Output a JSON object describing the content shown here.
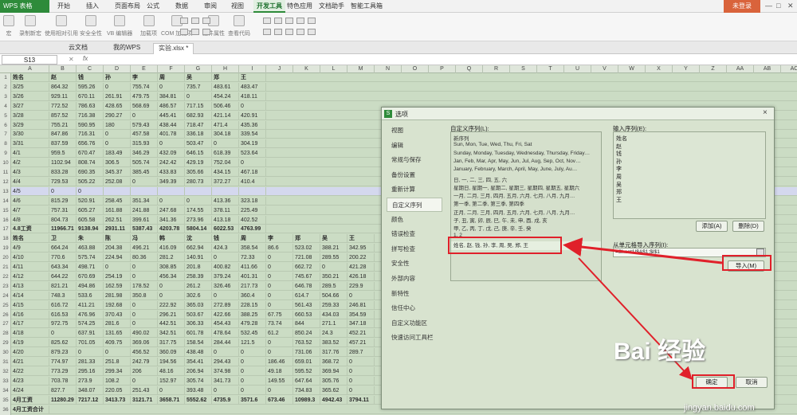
{
  "app": {
    "name": "WPS 表格"
  },
  "menu": [
    "开始",
    "插入",
    "页面布局",
    "公式",
    "数据",
    "审阅",
    "视图",
    "开发工具",
    "特色应用",
    "文档助手",
    "智能工具箱"
  ],
  "active_menu_index": 7,
  "login_label": "未登录",
  "toolbar": [
    "宏",
    "录制新宏",
    "使用相对引用",
    "安全全性",
    "VB 编辑器",
    "加载项",
    "COM 加载项",
    "控件属性",
    "查看代码"
  ],
  "doc_tabs": [
    "云文档",
    "我的WPS",
    "实验.xlsx *"
  ],
  "active_doc_tab_index": 2,
  "namebox": "S13",
  "fx": "fx",
  "columns": [
    "A",
    "B",
    "C",
    "D",
    "E",
    "F",
    "G",
    "H",
    "I",
    "J",
    "K",
    "L",
    "M",
    "N",
    "O",
    "P",
    "Q",
    "R",
    "S",
    "T",
    "U",
    "V",
    "W",
    "X",
    "Y",
    "Z",
    "AA",
    "AB",
    "AC"
  ],
  "rows": [
    {
      "n": "1",
      "c": [
        "姓名",
        "赵",
        "钱",
        "孙",
        "李",
        "周",
        "吴",
        "郑",
        "王"
      ],
      "b": true
    },
    {
      "n": "2",
      "c": [
        "3/25",
        "864.32",
        "595.26",
        "0",
        "755.74",
        "0",
        "735.7",
        "483.61",
        "483.47"
      ]
    },
    {
      "n": "3",
      "c": [
        "3/26",
        "929.11",
        "670.11",
        "261.91",
        "479.75",
        "384.81",
        "0",
        "454.24",
        "418.11"
      ]
    },
    {
      "n": "4",
      "c": [
        "3/27",
        "772.52",
        "786.63",
        "428.65",
        "568.69",
        "486.57",
        "717.15",
        "506.46",
        "0"
      ]
    },
    {
      "n": "5",
      "c": [
        "3/28",
        "857.52",
        "716.38",
        "290.27",
        "0",
        "445.41",
        "682.93",
        "421.14",
        "420.91"
      ]
    },
    {
      "n": "6",
      "c": [
        "3/29",
        "755.21",
        "590.95",
        "180",
        "579.43",
        "438.44",
        "718.47",
        "471.4",
        "435.36"
      ]
    },
    {
      "n": "7",
      "c": [
        "3/30",
        "847.86",
        "716.31",
        "0",
        "457.58",
        "401.78",
        "336.18",
        "304.18",
        "339.54"
      ]
    },
    {
      "n": "8",
      "c": [
        "3/31",
        "837.59",
        "656.76",
        "0",
        "315.93",
        "0",
        "503.47",
        "0",
        "304.19"
      ]
    },
    {
      "n": "9",
      "c": [
        "4/1",
        "959.5",
        "670.47",
        "183.49",
        "346.29",
        "432.09",
        "646.15",
        "618.39",
        "523.64"
      ]
    },
    {
      "n": "10",
      "c": [
        "4/2",
        "1102.94",
        "808.74",
        "306.5",
        "505.74",
        "242.42",
        "429.19",
        "752.04",
        "0"
      ]
    },
    {
      "n": "11",
      "c": [
        "4/3",
        "833.28",
        "690.35",
        "345.37",
        "385.45",
        "433.83",
        "305.66",
        "434.15",
        "467.18"
      ]
    },
    {
      "n": "12",
      "c": [
        "4/4",
        "729.53",
        "505.22",
        "252.08",
        "0",
        "349.39",
        "280.73",
        "372.27",
        "410.4"
      ]
    },
    {
      "n": "13",
      "c": [
        "4/5",
        "0",
        "0",
        "",
        "",
        "",
        "",
        "",
        ""
      ]
    },
    {
      "n": "14",
      "c": [
        "4/6",
        "815.29",
        "520.91",
        "258.45",
        "351.34",
        "0",
        "0",
        "413.36",
        "323.18"
      ]
    },
    {
      "n": "15",
      "c": [
        "4/7",
        "757.31",
        "605.27",
        "161.88",
        "241.88",
        "247.68",
        "174.55",
        "378.11",
        "225.49"
      ]
    },
    {
      "n": "16",
      "c": [
        "4/8",
        "804.73",
        "605.58",
        "262.51",
        "399.61",
        "341.36",
        "273.96",
        "413.18",
        "402.52"
      ]
    },
    {
      "n": "17",
      "c": [
        "4.8工资",
        "11966.71",
        "9138.94",
        "2931.11",
        "5387.43",
        "4203.78",
        "5804.14",
        "6022.53",
        "4763.99"
      ],
      "b": true
    },
    {
      "n": "18",
      "c": [
        "姓名",
        "卫",
        "朱",
        "陈",
        "冯",
        "韩",
        "沈",
        "钱",
        "周",
        "李",
        "郑",
        "吴",
        "王"
      ],
      "b": true
    },
    {
      "n": "19",
      "c": [
        "4/9",
        "664.24",
        "463.88",
        "204.38",
        "496.21",
        "416.09",
        "662.94",
        "424.3",
        "358.54",
        "86.6",
        "523.02",
        "388.21",
        "342.95"
      ]
    },
    {
      "n": "20",
      "c": [
        "4/10",
        "770.6",
        "575.74",
        "224.94",
        "80.36",
        "281.2",
        "140.91",
        "0",
        "72.33",
        "0",
        "721.08",
        "289.55",
        "200.22"
      ]
    },
    {
      "n": "21",
      "c": [
        "4/11",
        "643.34",
        "498.71",
        "0",
        "0",
        "308.85",
        "201.8",
        "400.82",
        "411.66",
        "0",
        "662.72",
        "0",
        "421.28"
      ]
    },
    {
      "n": "22",
      "c": [
        "4/12",
        "644.22",
        "670.69",
        "254.19",
        "0",
        "456.34",
        "258.39",
        "379.24",
        "401.31",
        "0",
        "745.67",
        "350.21",
        "426.18"
      ]
    },
    {
      "n": "23",
      "c": [
        "4/13",
        "821.21",
        "494.86",
        "162.59",
        "178.52",
        "0",
        "261.2",
        "326.46",
        "217.73",
        "0",
        "646.78",
        "289.5",
        "229.9"
      ]
    },
    {
      "n": "24",
      "c": [
        "4/14",
        "748.3",
        "533.6",
        "281.98",
        "350.8",
        "0",
        "302.6",
        "0",
        "360.4",
        "0",
        "614.7",
        "504.66",
        "0"
      ]
    },
    {
      "n": "25",
      "c": [
        "4/15",
        "616.72",
        "411.21",
        "192.68",
        "0",
        "222.92",
        "365.03",
        "272.89",
        "228.15",
        "0",
        "561.43",
        "259.33",
        "246.81"
      ]
    },
    {
      "n": "26",
      "c": [
        "4/16",
        "616.53",
        "476.96",
        "370.43",
        "0",
        "296.21",
        "503.67",
        "422.66",
        "388.25",
        "67.75",
        "660.53",
        "434.03",
        "354.59"
      ]
    },
    {
      "n": "27",
      "c": [
        "4/17",
        "972.75",
        "574.25",
        "281.6",
        "0",
        "442.51",
        "306.33",
        "454.43",
        "479.28",
        "73.74",
        "844",
        "271.1",
        "347.18"
      ]
    },
    {
      "n": "28",
      "c": [
        "4/18",
        "0",
        "637.91",
        "131.65",
        "490.02",
        "342.51",
        "601.78",
        "478.64",
        "532.45",
        "61.2",
        "850.24",
        "24.3",
        "452.21"
      ]
    },
    {
      "n": "29",
      "c": [
        "4/19",
        "825.62",
        "701.05",
        "409.75",
        "369.06",
        "317.75",
        "158.54",
        "284.44",
        "121.5",
        "0",
        "763.52",
        "383.52",
        "457.21"
      ]
    },
    {
      "n": "30",
      "c": [
        "4/20",
        "879.23",
        "0",
        "0",
        "456.52",
        "360.09",
        "438.48",
        "0",
        "0",
        "0",
        "731.06",
        "317.76",
        "289.7"
      ]
    },
    {
      "n": "31",
      "c": [
        "4/21",
        "774.97",
        "281.33",
        "251.8",
        "242.79",
        "194.56",
        "354.41",
        "294.43",
        "0",
        "186.46",
        "659.01",
        "368.72",
        "0"
      ]
    },
    {
      "n": "32",
      "c": [
        "4/22",
        "773.29",
        "295.16",
        "299.34",
        "206",
        "48.16",
        "206.94",
        "374.98",
        "0",
        "49.18",
        "595.52",
        "369.94",
        "0"
      ]
    },
    {
      "n": "33",
      "c": [
        "4/23",
        "703.78",
        "273.9",
        "108.2",
        "0",
        "152.97",
        "305.74",
        "341.73",
        "0",
        "149.55",
        "647.64",
        "305.76",
        "0"
      ]
    },
    {
      "n": "34",
      "c": [
        "4/24",
        "827.7",
        "348.07",
        "220.05",
        "251.43",
        "0",
        "393.48",
        "0",
        "0",
        "0",
        "734.83",
        "365.62",
        "0"
      ]
    },
    {
      "n": "35",
      "c": [
        "4月工资",
        "11280.29",
        "7217.12",
        "3413.73",
        "3121.71",
        "3658.71",
        "5552.62",
        "4735.9",
        "3571.6",
        "673.46",
        "10989.3",
        "4942.43",
        "3794.11"
      ],
      "b": true
    },
    {
      "n": "36",
      "c": [
        "4月工资合计"
      ],
      "b": true
    }
  ],
  "dialog": {
    "title": "选项",
    "close": "×",
    "nav": [
      "视图",
      "编辑",
      "常规与保存",
      "备份设置",
      "重新计算",
      "自定义序列",
      "颜色",
      "错误检查",
      "拼写检查",
      "安全性",
      "外部内容",
      "新特性",
      "信任中心",
      "自定义功能区",
      "快速访问工具栏"
    ],
    "nav_selected_index": 5,
    "custom_list_label": "自定义序列(L):",
    "custom_list": [
      "新序列",
      "Sun, Mon, Tue, Wed, Thu, Fri, Sat",
      "Sunday, Monday, Tuesday, Wednesday, Thursday, Friday…",
      "Jan, Feb, Mar, Apr, May, Jun, Jul, Aug, Sep, Oct, Nov…",
      "January, February, March, April, May, June, July, Au…",
      "日, 一, 二, 三, 四, 五, 六",
      "星期日, 星期一, 星期二, 星期三, 星期四, 星期五, 星期六",
      "一月, 二月, 三月, 四月, 五月, 六月, 七月, 八月, 九月…",
      "第一季, 第二季, 第三季, 第四季",
      "正月, 二月, 三月, 四月, 五月, 六月, 七月, 八月, 九月…",
      "子, 丑, 寅, 卯, 辰, 巳, 午, 未, 申, 酉, 戌, 亥",
      "甲, 乙, 丙, 丁, 戊, 己, 庚, 辛, 壬, 癸",
      "1, 2",
      "姓名, 赵, 钱, 孙, 李, 周, 吴, 郑, 王"
    ],
    "custom_list_selected_index": 13,
    "entries_label": "输入序列(E):",
    "entries": [
      "姓名",
      "赵",
      "钱",
      "孙",
      "李",
      "周",
      "吴",
      "郑",
      "王"
    ],
    "add_button": "添加(A)",
    "delete_button": "删除(D)",
    "import_label": "从单元格导入序列(I):",
    "import_value": "=Sheet1!$A$1:$I$1",
    "import_button": "导入(M)",
    "ok_button": "确定",
    "cancel_button": "取消"
  },
  "watermark": {
    "logo": "Bai 经验",
    "url": "jingyan.baidu.com"
  },
  "colors": {
    "accent": "#2e8b3a",
    "annotation": "#e0202a",
    "login": "#d9633b"
  }
}
